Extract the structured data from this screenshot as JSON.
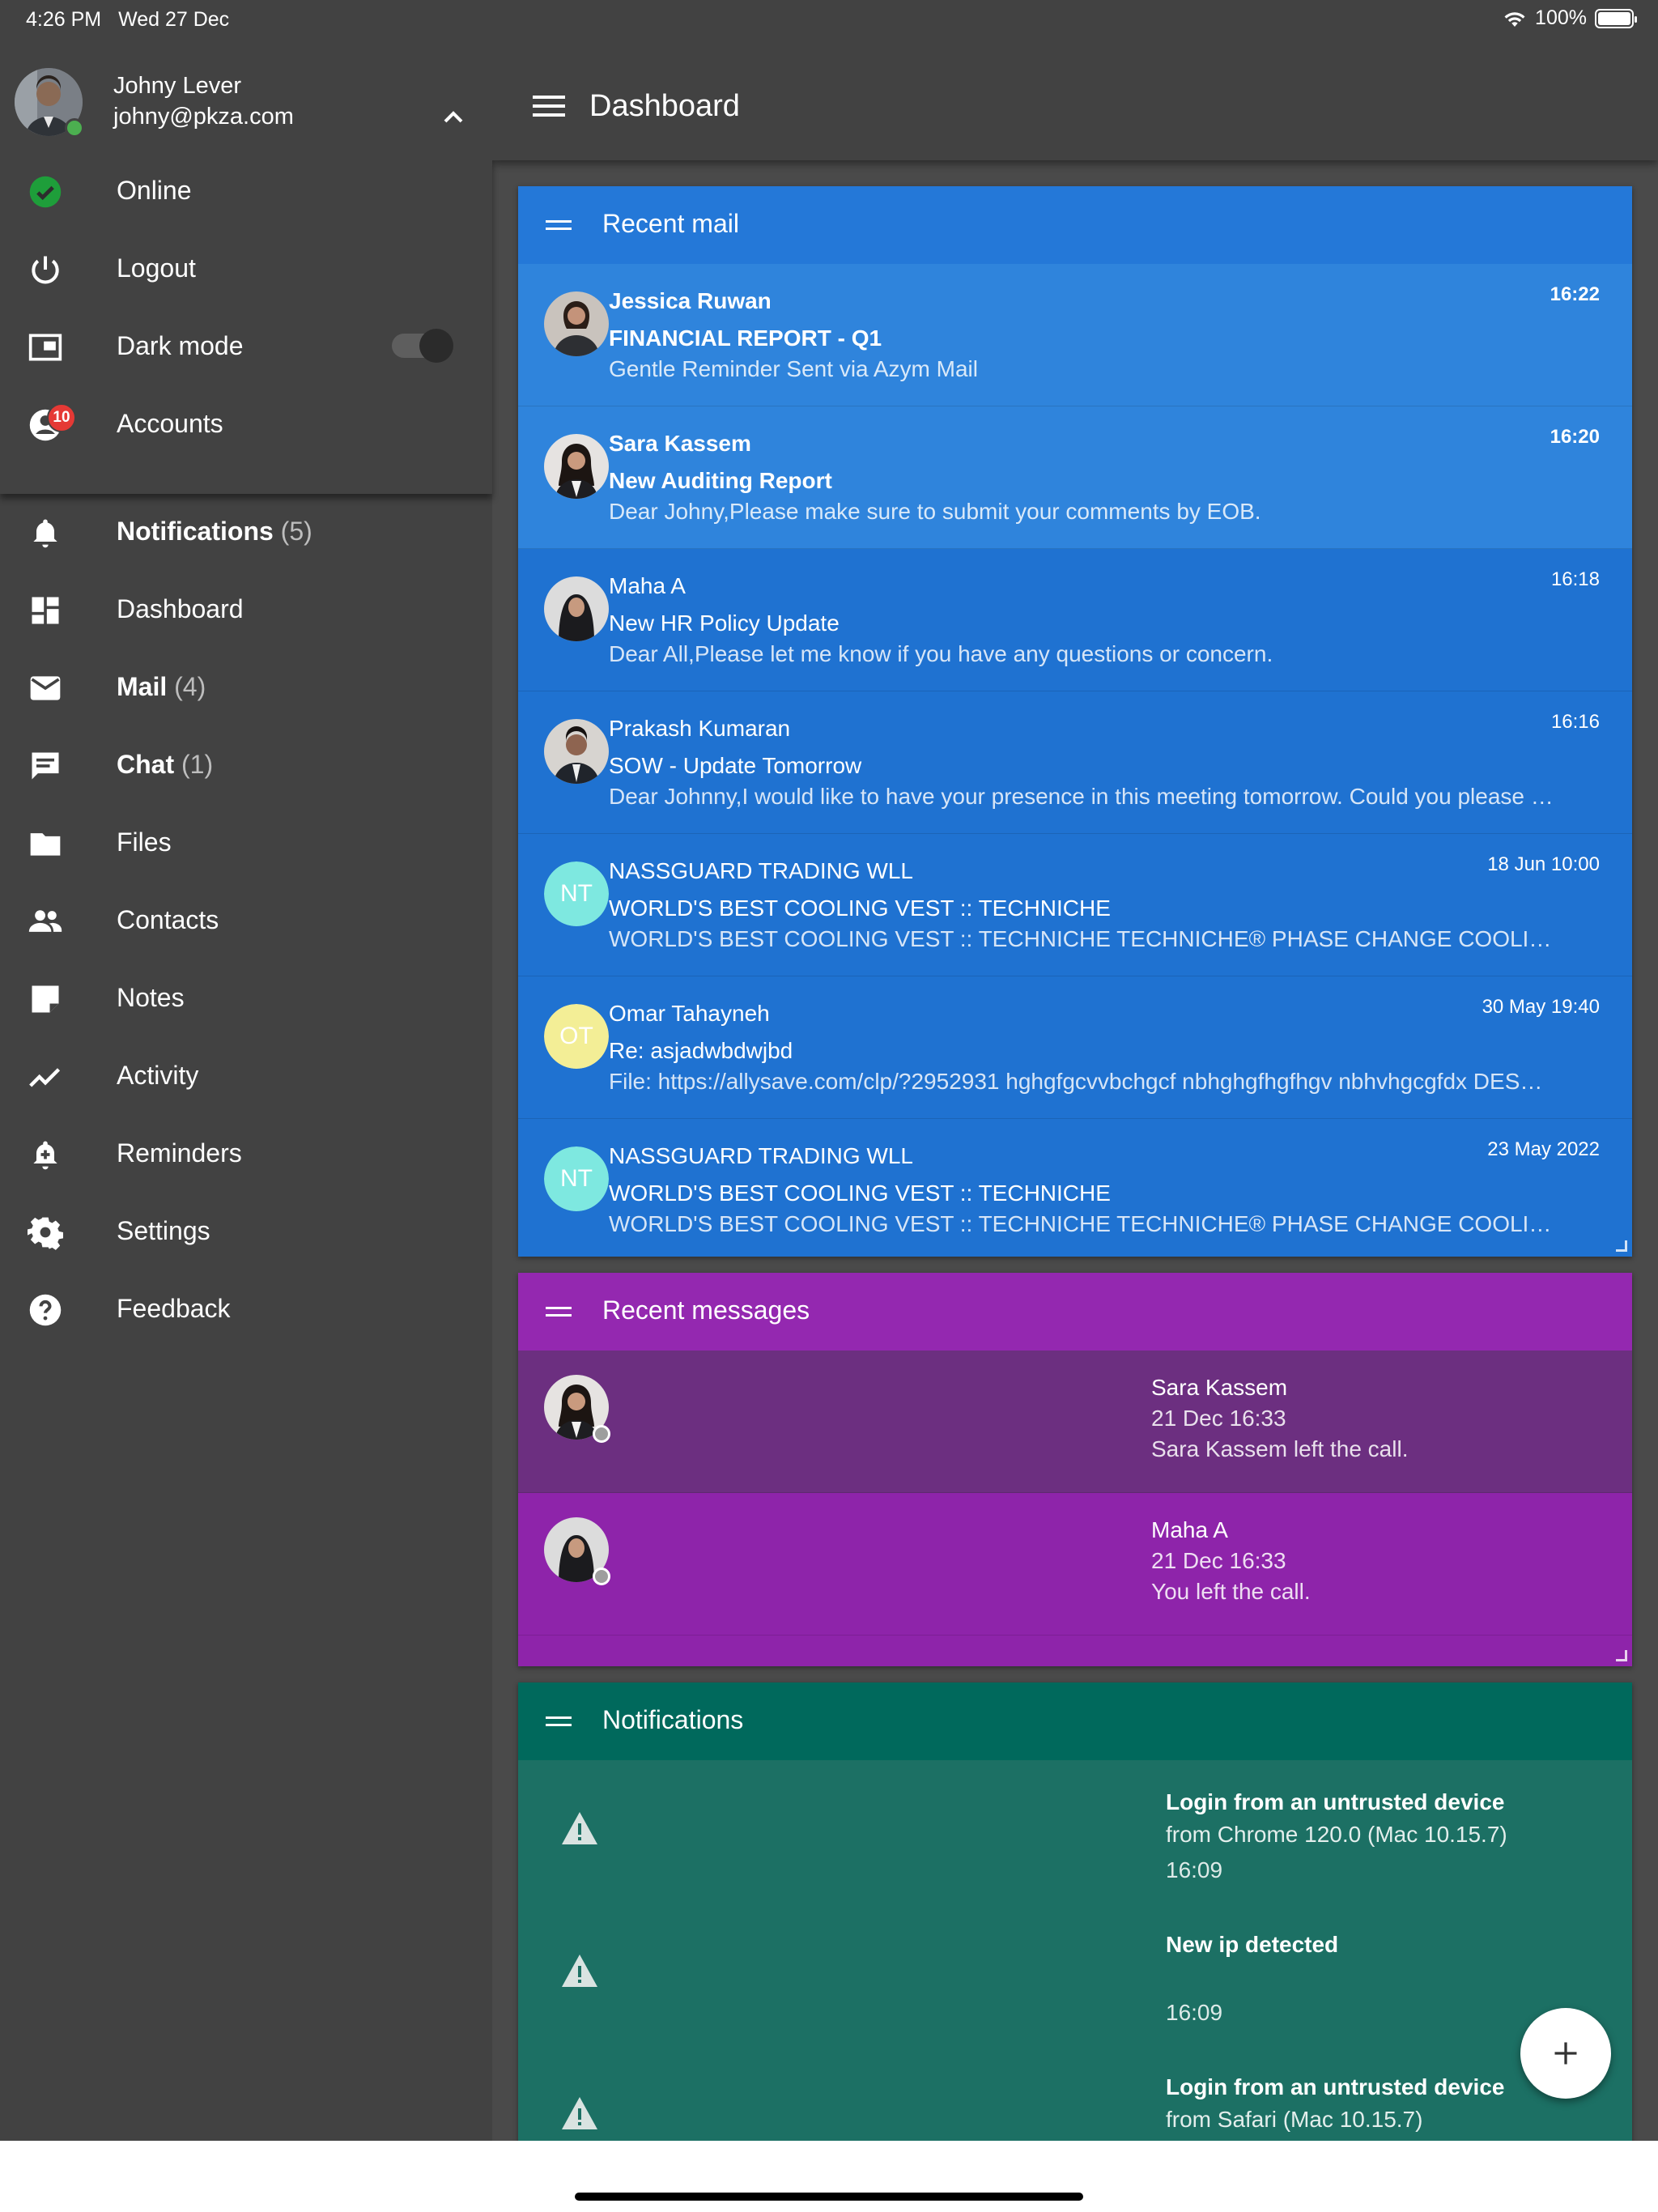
{
  "status_bar": {
    "time": "4:26 PM",
    "date": "Wed 27 Dec",
    "battery": "100%",
    "battery_level": 1.0
  },
  "profile": {
    "name": "Johny Lever",
    "email": "johny@pkza.com"
  },
  "account_menu": [
    {
      "label": "Online",
      "icon": "online-check-icon"
    },
    {
      "label": "Logout",
      "icon": "power-icon"
    },
    {
      "label": "Dark mode",
      "icon": "display-icon",
      "toggle_on": true
    },
    {
      "label": "Accounts",
      "icon": "account-icon",
      "badge": "10"
    }
  ],
  "nav": [
    {
      "label": "Notifications",
      "count": "(5)",
      "icon": "bell-icon",
      "bold": true
    },
    {
      "label": "Dashboard",
      "count": "",
      "icon": "dashboard-icon",
      "bold": false
    },
    {
      "label": "Mail",
      "count": "(4)",
      "icon": "mail-icon",
      "bold": true
    },
    {
      "label": "Chat",
      "count": "(1)",
      "icon": "chat-icon",
      "bold": true
    },
    {
      "label": "Files",
      "count": "",
      "icon": "folder-icon",
      "bold": false
    },
    {
      "label": "Contacts",
      "count": "",
      "icon": "people-icon",
      "bold": false
    },
    {
      "label": "Notes",
      "count": "",
      "icon": "note-icon",
      "bold": false
    },
    {
      "label": "Activity",
      "count": "",
      "icon": "trending-icon",
      "bold": false
    },
    {
      "label": "Reminders",
      "count": "",
      "icon": "bell-plus-icon",
      "bold": false
    },
    {
      "label": "Settings",
      "count": "",
      "icon": "gear-icon",
      "bold": false
    },
    {
      "label": "Feedback",
      "count": "",
      "icon": "help-icon",
      "bold": false
    }
  ],
  "appbar": {
    "title": "Dashboard"
  },
  "recent_mail": {
    "title": "Recent mail",
    "items": [
      {
        "sender": "Jessica Ruwan",
        "subject": "FINANCIAL REPORT - Q1",
        "preview": "Gentle Reminder Sent via Azym Mail",
        "time": "16:22",
        "unread": true
      },
      {
        "sender": "Sara Kassem",
        "subject": "New Auditing Report",
        "preview": "Dear Johny,Please make sure to submit your comments by EOB.",
        "time": "16:20",
        "unread": true
      },
      {
        "sender": "Maha A",
        "subject": "New HR Policy Update",
        "preview": "Dear All,Please let me know if you have any questions or concern.",
        "time": "16:18",
        "unread": false
      },
      {
        "sender": "Prakash Kumaran",
        "subject": "SOW - Update Tomorrow",
        "preview": "Dear Johnny,I would like to have your presence in this meeting tomorrow. Could you please …",
        "time": "16:16",
        "unread": false
      },
      {
        "sender": "NASSGUARD TRADING WLL",
        "subject": "WORLD'S BEST COOLING VEST :: TECHNICHE",
        "preview": "WORLD'S BEST COOLING VEST :: TECHNICHE TECHNICHE® PHASE CHANGE COOLING VE…",
        "time": "18 Jun 10:00",
        "unread": false,
        "initials": "NT",
        "color": "#7ee8e0"
      },
      {
        "sender": "Omar Tahayneh",
        "subject": "Re: asjadwbdwjbd",
        "preview": "File: https://allysave.com/clp/?2952931 hghgfgcvvbchgcf nbhghgfhgfhgv nbhvhgcgfdx DES…",
        "time": "30 May 19:40",
        "unread": false,
        "initials": "OT",
        "color": "#f3ee96"
      },
      {
        "sender": "NASSGUARD TRADING WLL",
        "subject": "WORLD'S BEST COOLING VEST :: TECHNICHE",
        "preview": "WORLD'S BEST COOLING VEST :: TECHNICHE TECHNICHE® PHASE CHANGE COOLING VE…",
        "time": "23 May 2022",
        "unread": false,
        "initials": "NT",
        "color": "#7ee8e0"
      }
    ]
  },
  "recent_messages": {
    "title": "Recent messages",
    "items": [
      {
        "name": "Sara Kassem",
        "time": "21 Dec 16:33",
        "text": "Sara Kassem left the call."
      },
      {
        "name": "Maha A",
        "time": "21 Dec 16:33",
        "text": "You left the call."
      }
    ]
  },
  "notifications": {
    "title": "Notifications",
    "items": [
      {
        "title": "Login from an untrusted device",
        "detail": "from Chrome 120.0 (Mac 10.15.7)",
        "time": "16:09"
      },
      {
        "title": "New ip detected",
        "detail": "",
        "time": "16:09"
      },
      {
        "title": "Login from an untrusted device",
        "detail": "from Safari (Mac 10.15.7)",
        "time": ""
      }
    ]
  },
  "colors": {
    "sidebar": "#424242",
    "mail_card": "#1f72d1",
    "messages_card": "#8e24aa",
    "notifications_card": "#00695c",
    "online": "#4caf50",
    "badge": "#e53935"
  }
}
